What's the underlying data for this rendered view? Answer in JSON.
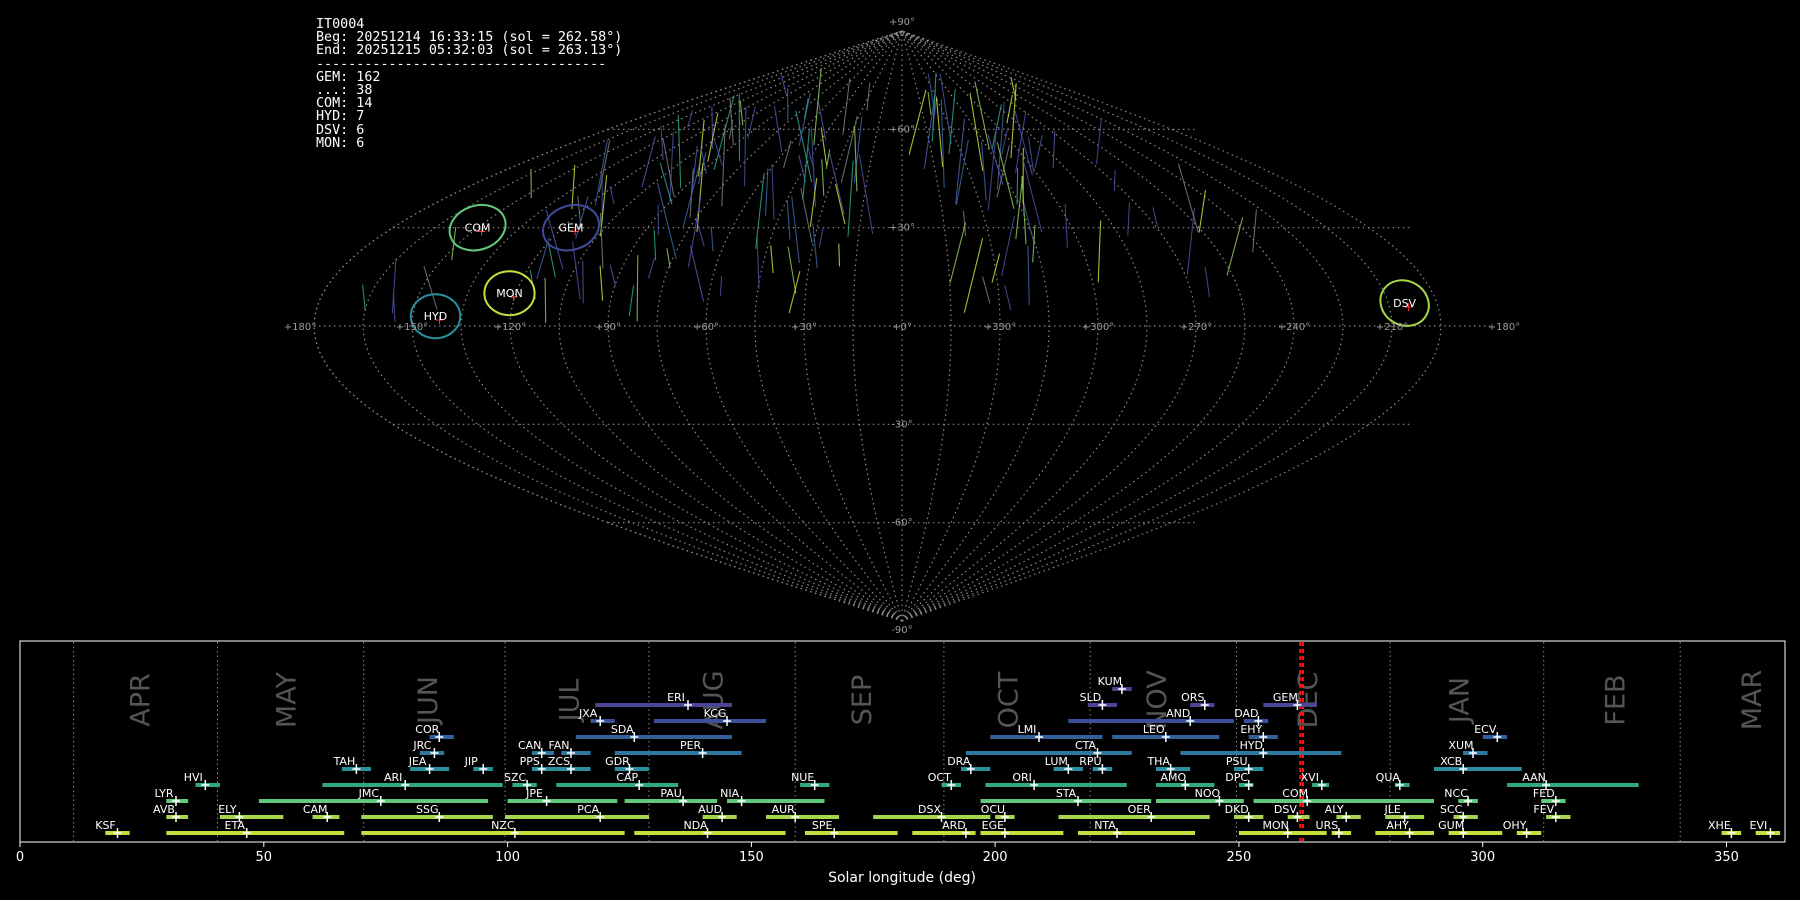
{
  "stats": {
    "camera": "IT0004",
    "beg": "Beg: 20251214 16:33:15 (sol = 262.58°)",
    "end": "End: 20251215 05:32:03 (sol = 263.13°)",
    "rule": "------------------------------------",
    "counts": [
      "GEM: 162",
      "...: 38",
      "COM: 14",
      "HYD: 7",
      "DSV: 6",
      "MON: 6"
    ]
  },
  "chart_data": [
    {
      "type": "scatter",
      "projection": "sinusoidal",
      "lon_labels": [
        "+180°",
        "+150°",
        "+120°",
        "+90°",
        "+60°",
        "+30°",
        "+0°",
        "+330°",
        "+300°",
        "+270°",
        "+240°",
        "+210°",
        "+180°"
      ],
      "lat_labels": [
        "+90°",
        "+60°",
        "+30°",
        "-30°",
        "-60°",
        "-90°"
      ],
      "radiants": [
        {
          "code": "COM",
          "lon": 150,
          "lat": 30,
          "color": "#62c87c"
        },
        {
          "code": "GEM",
          "lon": 117,
          "lat": 30,
          "color": "#3f4a9a"
        },
        {
          "code": "HYD",
          "lon": 143,
          "lat": 3,
          "color": "#2a8f9e"
        },
        {
          "code": "MON",
          "lon": 122,
          "lat": 10,
          "color": "#c8dc3c"
        },
        {
          "code": "DSV",
          "lon": 205,
          "lat": 7,
          "color": "#a6d44a"
        }
      ]
    },
    {
      "type": "bar",
      "xlabel": "Solar longitude (deg)",
      "xlim": [
        0,
        362
      ],
      "xticks": [
        0,
        50,
        100,
        150,
        200,
        250,
        300,
        350
      ],
      "months": [
        {
          "name": "APR",
          "sol": 24.5
        },
        {
          "name": "MAY",
          "sol": 54.5
        },
        {
          "name": "JUN",
          "sol": 83.5
        },
        {
          "name": "JUL",
          "sol": 112.5
        },
        {
          "name": "AUG",
          "sol": 142
        },
        {
          "name": "SEP",
          "sol": 172.5
        },
        {
          "name": "OCT",
          "sol": 202.5
        },
        {
          "name": "NOV",
          "sol": 233
        },
        {
          "name": "DEC",
          "sol": 264
        },
        {
          "name": "JAN",
          "sol": 295
        },
        {
          "name": "FEB",
          "sol": 327
        },
        {
          "name": "MAR",
          "sol": 355
        }
      ],
      "month_boundaries": [
        11,
        40.5,
        70.5,
        99.5,
        129,
        159,
        189.5,
        219.5,
        249.5,
        281,
        312.5,
        340.5
      ],
      "current_sol": [
        262.58,
        263.13
      ],
      "showers": [
        {
          "code": "KSF",
          "start": 17.5,
          "end": 22.5,
          "peak": 20,
          "row": 1,
          "color": "#c8dc3c"
        },
        {
          "code": "ETA",
          "start": 30,
          "end": 66.5,
          "peak": 46.5,
          "row": 1,
          "color": "#c8dc3c"
        },
        {
          "code": "NZC",
          "start": 70,
          "end": 124,
          "peak": 101.5,
          "row": 1,
          "color": "#c8dc3c"
        },
        {
          "code": "NDA",
          "start": 126,
          "end": 157,
          "peak": 141,
          "row": 1,
          "color": "#c8dc3c"
        },
        {
          "code": "SPE",
          "start": 161,
          "end": 180,
          "peak": 167,
          "row": 1,
          "color": "#c8dc3c"
        },
        {
          "code": "ARD",
          "start": 183,
          "end": 196,
          "peak": 194,
          "row": 1,
          "color": "#c8dc3c"
        },
        {
          "code": "EGE",
          "start": 197,
          "end": 214,
          "peak": 202,
          "row": 1,
          "color": "#c8dc3c"
        },
        {
          "code": "NTA",
          "start": 217,
          "end": 241,
          "peak": 225,
          "row": 1,
          "color": "#c8dc3c"
        },
        {
          "code": "MON",
          "start": 250,
          "end": 268,
          "peak": 260,
          "row": 1,
          "color": "#c8dc3c"
        },
        {
          "code": "URS",
          "start": 269,
          "end": 273,
          "peak": 270.5,
          "row": 1,
          "color": "#c8dc3c"
        },
        {
          "code": "AHY",
          "start": 278,
          "end": 290,
          "peak": 285,
          "row": 1,
          "color": "#c8dc3c"
        },
        {
          "code": "GUM",
          "start": 293,
          "end": 304,
          "peak": 296,
          "row": 1,
          "color": "#c8dc3c"
        },
        {
          "code": "OHY",
          "start": 307,
          "end": 312,
          "peak": 309,
          "row": 1,
          "color": "#c8dc3c"
        },
        {
          "code": "XHE",
          "start": 349,
          "end": 353,
          "peak": 351,
          "row": 1,
          "color": "#c8dc3c"
        },
        {
          "code": "EVI",
          "start": 356,
          "end": 361,
          "peak": 359,
          "row": 1,
          "color": "#c8dc3c"
        },
        {
          "code": "AVB",
          "start": 30,
          "end": 34.5,
          "peak": 32,
          "row": 2,
          "color": "#a6d44a"
        },
        {
          "code": "ELY",
          "start": 41,
          "end": 54,
          "peak": 45,
          "row": 2,
          "color": "#a6d44a"
        },
        {
          "code": "CAM",
          "start": 60,
          "end": 65.5,
          "peak": 63,
          "row": 2,
          "color": "#a6d44a"
        },
        {
          "code": "SSG",
          "start": 70,
          "end": 97,
          "peak": 86,
          "row": 2,
          "color": "#a6d44a"
        },
        {
          "code": "PCA",
          "start": 99.5,
          "end": 129,
          "peak": 119,
          "row": 2,
          "color": "#a6d44a"
        },
        {
          "code": "AUD",
          "start": 140,
          "end": 147,
          "peak": 144,
          "row": 2,
          "color": "#a6d44a"
        },
        {
          "code": "AUR",
          "start": 153,
          "end": 168,
          "peak": 159,
          "row": 2,
          "color": "#a6d44a"
        },
        {
          "code": "DSX",
          "start": 175,
          "end": 199,
          "peak": 189,
          "row": 2,
          "color": "#a6d44a"
        },
        {
          "code": "OCU",
          "start": 200,
          "end": 204,
          "peak": 202,
          "row": 2,
          "color": "#a6d44a"
        },
        {
          "code": "OER",
          "start": 213,
          "end": 244,
          "peak": 232,
          "row": 2,
          "color": "#a6d44a"
        },
        {
          "code": "DKD",
          "start": 249,
          "end": 255,
          "peak": 252,
          "row": 2,
          "color": "#a6d44a"
        },
        {
          "code": "DSV",
          "start": 260,
          "end": 264.5,
          "peak": 262,
          "row": 2,
          "color": "#a6d44a"
        },
        {
          "code": "ALY",
          "start": 270,
          "end": 275,
          "peak": 272,
          "row": 2,
          "color": "#a6d44a"
        },
        {
          "code": "JLE",
          "start": 280,
          "end": 288,
          "peak": 284,
          "row": 2,
          "color": "#a6d44a"
        },
        {
          "code": "SCC",
          "start": 294,
          "end": 299,
          "peak": 296,
          "row": 2,
          "color": "#a6d44a"
        },
        {
          "code": "FEV",
          "start": 313,
          "end": 318,
          "peak": 315,
          "row": 2,
          "color": "#a6d44a"
        },
        {
          "code": "LYR",
          "start": 30,
          "end": 34.5,
          "peak": 32,
          "row": 3,
          "color": "#62c87c"
        },
        {
          "code": "JMC",
          "start": 49,
          "end": 96,
          "peak": 74,
          "row": 3,
          "color": "#62c87c"
        },
        {
          "code": "JPE",
          "start": 100,
          "end": 122.5,
          "peak": 108,
          "row": 3,
          "color": "#62c87c"
        },
        {
          "code": "PAU",
          "start": 124,
          "end": 143,
          "peak": 136,
          "row": 3,
          "color": "#62c87c"
        },
        {
          "code": "NIA",
          "start": 145,
          "end": 165,
          "peak": 148,
          "row": 3,
          "color": "#62c87c"
        },
        {
          "code": "STA",
          "start": 197,
          "end": 232,
          "peak": 217,
          "row": 3,
          "color": "#62c87c"
        },
        {
          "code": "NOO",
          "start": 233,
          "end": 251,
          "peak": 246,
          "row": 3,
          "color": "#62c87c"
        },
        {
          "code": "COM",
          "start": 253,
          "end": 290,
          "peak": 264,
          "row": 3,
          "color": "#62c87c"
        },
        {
          "code": "NCC",
          "start": 295,
          "end": 299,
          "peak": 297,
          "row": 3,
          "color": "#62c87c"
        },
        {
          "code": "FED",
          "start": 312,
          "end": 317,
          "peak": 315,
          "row": 3,
          "color": "#62c87c"
        },
        {
          "code": "HVI",
          "start": 36,
          "end": 41,
          "peak": 38,
          "row": 4,
          "color": "#2ea885"
        },
        {
          "code": "ARI",
          "start": 62,
          "end": 99,
          "peak": 79,
          "row": 4,
          "color": "#2ea885"
        },
        {
          "code": "SZC",
          "start": 101,
          "end": 106,
          "peak": 104,
          "row": 4,
          "color": "#2ea885"
        },
        {
          "code": "CAP",
          "start": 110,
          "end": 135,
          "peak": 127,
          "row": 4,
          "color": "#2ea885"
        },
        {
          "code": "NUE",
          "start": 160,
          "end": 166,
          "peak": 163,
          "row": 4,
          "color": "#2ea885"
        },
        {
          "code": "OCT",
          "start": 189,
          "end": 193,
          "peak": 191,
          "row": 4,
          "color": "#2ea885"
        },
        {
          "code": "ORI",
          "start": 198,
          "end": 227,
          "peak": 208,
          "row": 4,
          "color": "#2ea885"
        },
        {
          "code": "AMO",
          "start": 233,
          "end": 245,
          "peak": 239,
          "row": 4,
          "color": "#2ea885"
        },
        {
          "code": "DPC",
          "start": 250,
          "end": 253,
          "peak": 252,
          "row": 4,
          "color": "#2ea885"
        },
        {
          "code": "XVI",
          "start": 265,
          "end": 268.5,
          "peak": 267,
          "row": 4,
          "color": "#2ea885"
        },
        {
          "code": "QUA",
          "start": 282,
          "end": 285,
          "peak": 283,
          "row": 4,
          "color": "#2ea885"
        },
        {
          "code": "AAN",
          "start": 305,
          "end": 332,
          "peak": 313,
          "row": 4,
          "color": "#2ea885"
        },
        {
          "code": "TAH",
          "start": 66,
          "end": 72,
          "peak": 69,
          "row": 5,
          "color": "#2a8f9e"
        },
        {
          "code": "JEA",
          "start": 80,
          "end": 88,
          "peak": 84,
          "row": 5,
          "color": "#2a8f9e"
        },
        {
          "code": "JIP",
          "start": 93,
          "end": 97,
          "peak": 95,
          "row": 5,
          "color": "#2a8f9e"
        },
        {
          "code": "PPS",
          "start": 105,
          "end": 110,
          "peak": 107,
          "row": 5,
          "color": "#2a8f9e"
        },
        {
          "code": "ZCS",
          "start": 110,
          "end": 117,
          "peak": 113,
          "row": 5,
          "color": "#2a8f9e"
        },
        {
          "code": "GDR",
          "start": 122,
          "end": 129,
          "peak": 125,
          "row": 5,
          "color": "#2a8f9e"
        },
        {
          "code": "DRA",
          "start": 193,
          "end": 199,
          "peak": 195,
          "row": 5,
          "color": "#2a8f9e"
        },
        {
          "code": "LUM",
          "start": 212,
          "end": 218,
          "peak": 215,
          "row": 5,
          "color": "#2a8f9e"
        },
        {
          "code": "RPU",
          "start": 220,
          "end": 224,
          "peak": 222,
          "row": 5,
          "color": "#2a8f9e"
        },
        {
          "code": "THA",
          "start": 233,
          "end": 240,
          "peak": 236,
          "row": 5,
          "color": "#2a8f9e"
        },
        {
          "code": "PSU",
          "start": 249,
          "end": 255,
          "peak": 252,
          "row": 5,
          "color": "#2a8f9e"
        },
        {
          "code": "XCB",
          "start": 290,
          "end": 308,
          "peak": 296,
          "row": 5,
          "color": "#2a8f9e"
        },
        {
          "code": "JRC",
          "start": 82,
          "end": 87,
          "peak": 85,
          "row": 6,
          "color": "#2e779e"
        },
        {
          "code": "CAN",
          "start": 105,
          "end": 109.5,
          "peak": 107,
          "row": 6,
          "color": "#2e779e"
        },
        {
          "code": "FAN",
          "start": 111,
          "end": 117,
          "peak": 113,
          "row": 6,
          "color": "#2e779e"
        },
        {
          "code": "PER",
          "start": 122,
          "end": 148,
          "peak": 140,
          "row": 6,
          "color": "#2e779e"
        },
        {
          "code": "CTA",
          "start": 194,
          "end": 228,
          "peak": 221,
          "row": 6,
          "color": "#2e779e"
        },
        {
          "code": "HYD",
          "start": 238,
          "end": 271,
          "peak": 255,
          "row": 6,
          "color": "#2e779e"
        },
        {
          "code": "XUM",
          "start": 296,
          "end": 301,
          "peak": 298,
          "row": 6,
          "color": "#2e779e"
        },
        {
          "code": "COR",
          "start": 84,
          "end": 89,
          "peak": 86,
          "row": 7,
          "color": "#34609a"
        },
        {
          "code": "SDA",
          "start": 114,
          "end": 146,
          "peak": 126,
          "row": 7,
          "color": "#34609a"
        },
        {
          "code": "LMI",
          "start": 199,
          "end": 222,
          "peak": 209,
          "row": 7,
          "color": "#34609a"
        },
        {
          "code": "LEO",
          "start": 224,
          "end": 246,
          "peak": 235,
          "row": 7,
          "color": "#34609a"
        },
        {
          "code": "EHY",
          "start": 252,
          "end": 258,
          "peak": 255,
          "row": 7,
          "color": "#34609a"
        },
        {
          "code": "ECV",
          "start": 300,
          "end": 305,
          "peak": 303,
          "row": 7,
          "color": "#34609a"
        },
        {
          "code": "JXA",
          "start": 117,
          "end": 122,
          "peak": 119,
          "row": 8,
          "color": "#3b5098"
        },
        {
          "code": "KCG",
          "start": 130,
          "end": 153,
          "peak": 145,
          "row": 8,
          "color": "#3b5098"
        },
        {
          "code": "AND",
          "start": 215,
          "end": 249,
          "peak": 240,
          "row": 8,
          "color": "#3b5098"
        },
        {
          "code": "DAD",
          "start": 251,
          "end": 256,
          "peak": 254,
          "row": 8,
          "color": "#3b5098"
        },
        {
          "code": "ERI",
          "start": 118,
          "end": 146,
          "peak": 137,
          "row": 9,
          "color": "#4a4695"
        },
        {
          "code": "SLD",
          "start": 219,
          "end": 225,
          "peak": 222,
          "row": 9,
          "color": "#4a4695"
        },
        {
          "code": "ORS",
          "start": 240,
          "end": 245,
          "peak": 243,
          "row": 9,
          "color": "#4a4695"
        },
        {
          "code": "GEM",
          "start": 255,
          "end": 266,
          "peak": 262,
          "row": 9,
          "color": "#4a4695"
        },
        {
          "code": "KUM",
          "start": 224,
          "end": 228,
          "peak": 226,
          "row": 10,
          "color": "#4a4695"
        }
      ]
    }
  ]
}
